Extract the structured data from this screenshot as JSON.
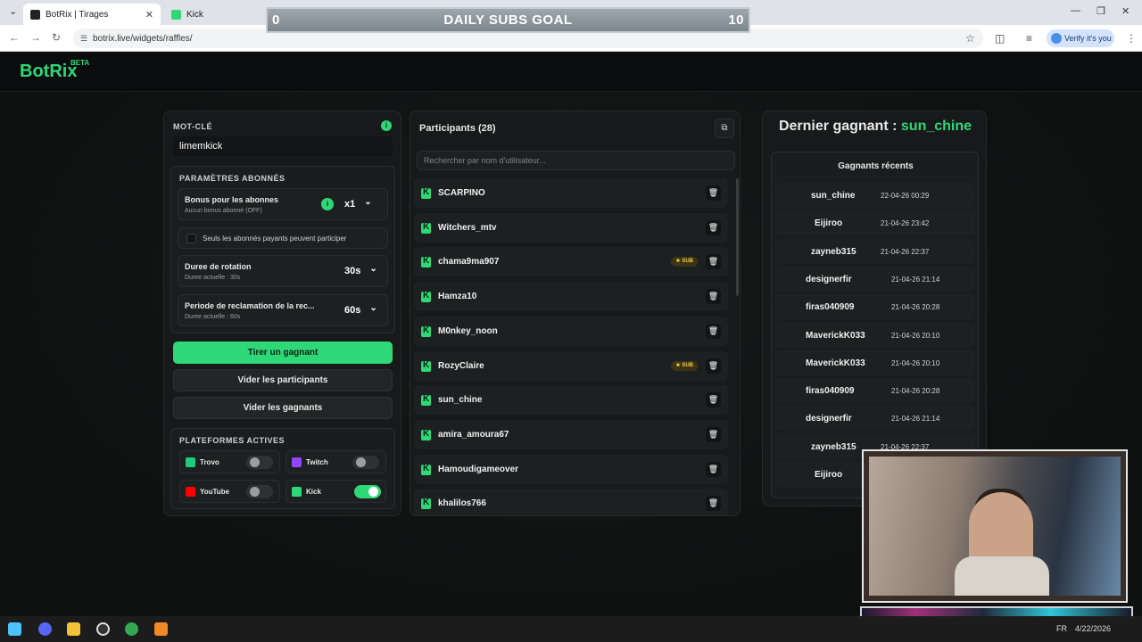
{
  "browser": {
    "tabs": [
      {
        "title": "BotRix | Tirages",
        "active": true
      },
      {
        "title": "Kick",
        "active": false
      }
    ],
    "url": "botrix.live/widgets/raffles/",
    "verify_label": "Verify it's you"
  },
  "overlay_goal": {
    "title": "DAILY SUBS GOAL",
    "current": "0",
    "target": "10"
  },
  "app": {
    "logo": "BotRix",
    "logo_badge": "BETA"
  },
  "settings": {
    "keyword_label": "MOT-CLÉ",
    "keyword_value": "limemkick",
    "subs_section_label": "PARAMÈTRES ABONNÉS",
    "bonus_title": "Bonus pour les abonnes",
    "bonus_sub": "Aucun bonus abonné (OFF)",
    "bonus_value": "x1",
    "paid_only_label": "Seuls les abonnés payants peuvent participer",
    "rotation_title": "Duree de rotation",
    "rotation_sub": "Duree actuelle : 30s",
    "rotation_value": "30s",
    "claim_title": "Periode de reclamation de la rec...",
    "claim_sub": "Duree actuelle : 60s",
    "claim_value": "60s",
    "draw_button": "Tirer un gagnant",
    "clear_participants_button": "Vider les participants",
    "clear_winners_button": "Vider les gagnants",
    "platforms_label": "PLATEFORMES ACTIVES",
    "platforms": [
      {
        "name": "Trovo",
        "enabled": false,
        "color": "#1ecb7b"
      },
      {
        "name": "Twitch",
        "enabled": false,
        "color": "#9146ff"
      },
      {
        "name": "YouTube",
        "enabled": false,
        "color": "#ff0000"
      },
      {
        "name": "Kick",
        "enabled": true,
        "color": "#2fd876"
      }
    ]
  },
  "participants": {
    "title": "Participants (28)",
    "search_placeholder": "Rechercher par nom d'utilisateur...",
    "sub_badge": "SUB",
    "items": [
      {
        "name": "SCARPINO",
        "sub": false
      },
      {
        "name": "Witchers_mtv",
        "sub": false
      },
      {
        "name": "chama9ma907",
        "sub": true
      },
      {
        "name": "Hamza10",
        "sub": false
      },
      {
        "name": "M0nkey_noon",
        "sub": false
      },
      {
        "name": "RozyClaire",
        "sub": true
      },
      {
        "name": "sun_chine",
        "sub": false
      },
      {
        "name": "amira_amoura67",
        "sub": false
      },
      {
        "name": "Hamoudigameover",
        "sub": false
      },
      {
        "name": "khalilos766",
        "sub": false
      }
    ]
  },
  "winners": {
    "last_winner_label": "Dernier gagnant :",
    "last_winner_name": "sun_chine",
    "recent_title": "Gagnants récents",
    "items": [
      {
        "name": "sun_chine",
        "time": "22-04-26 00:29"
      },
      {
        "name": "Eijiroo",
        "time": "21-04-26 23:42"
      },
      {
        "name": "zayneb315",
        "time": "21-04-26 22:37"
      },
      {
        "name": "designerfir",
        "time": "21-04-26 21:14"
      },
      {
        "name": "firas040909",
        "time": "21-04-26 20:28"
      },
      {
        "name": "MaverickK033",
        "time": "21-04-26 20:10"
      },
      {
        "name": "MaverickK033",
        "time": "21-04-26 20:10"
      },
      {
        "name": "firas040909",
        "time": "21-04-26 20:28"
      },
      {
        "name": "designerfir",
        "time": "21-04-26 21:14"
      },
      {
        "name": "zayneb315",
        "time": "21-04-26 22:37"
      },
      {
        "name": "Eijiroo",
        "time": ""
      }
    ]
  },
  "taskbar": {
    "lang": "FR",
    "date": "4/22/2026"
  },
  "colors": {
    "accent": "#2fd876",
    "background": "#0e1011",
    "panel": "#17191a"
  }
}
